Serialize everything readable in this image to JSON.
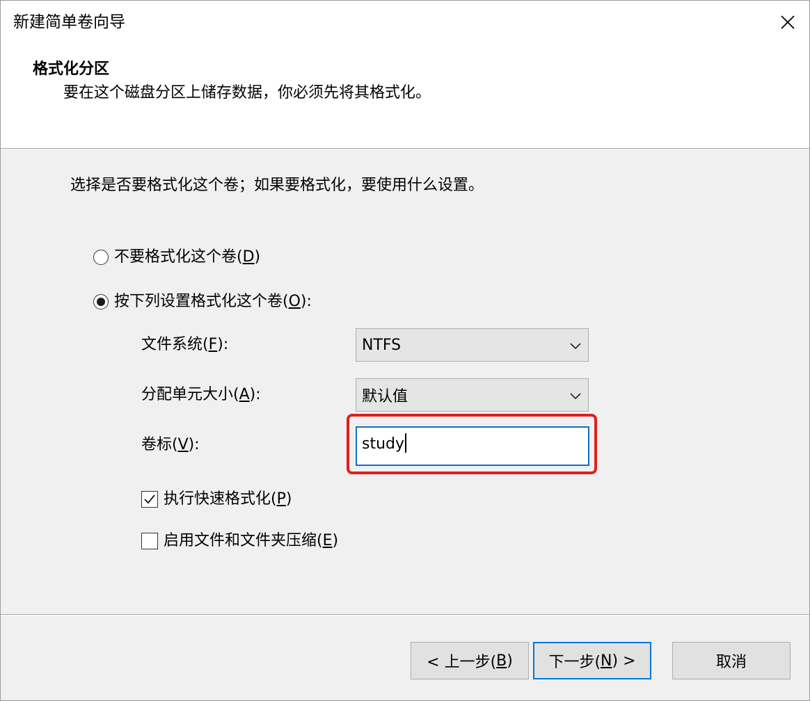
{
  "window": {
    "title": "新建简单卷向导"
  },
  "header": {
    "heading": "格式化分区",
    "subheading": "要在这个磁盘分区上储存数据，你必须先将其格式化。"
  },
  "instruction": "选择是否要格式化这个卷；如果要格式化，要使用什么设置。",
  "options": {
    "no_format": {
      "label": "不要格式化这个卷(",
      "key": "D",
      "suffix": ")",
      "selected": false
    },
    "format": {
      "label": "按下列设置格式化这个卷(",
      "key": "O",
      "suffix": "):",
      "selected": true
    }
  },
  "fields": {
    "file_system": {
      "label": "文件系统(",
      "key": "F",
      "suffix": "):",
      "value": "NTFS"
    },
    "allocation_unit": {
      "label": "分配单元大小(",
      "key": "A",
      "suffix": "):",
      "value": "默认值"
    },
    "volume_label": {
      "label": "卷标(",
      "key": "V",
      "suffix": "):",
      "value": "study"
    }
  },
  "checkboxes": {
    "quick_format": {
      "label": "执行快速格式化(",
      "key": "P",
      "suffix": ")",
      "checked": true
    },
    "compression": {
      "label": "启用文件和文件夹压缩(",
      "key": "E",
      "suffix": ")",
      "checked": false
    }
  },
  "buttons": {
    "back": {
      "prefix": "< 上一步(",
      "key": "B",
      "suffix": ")"
    },
    "next": {
      "prefix": "下一步(",
      "key": "N",
      "suffix": ") >"
    },
    "cancel": {
      "label": "取消"
    }
  },
  "colors": {
    "highlight": "#e0201a",
    "focus_border": "#0e6fc7",
    "default_button_border": "#0078d7"
  },
  "icons": {
    "close": "close-icon",
    "dropdown": "chevron-down-icon",
    "check": "checkmark-icon"
  }
}
